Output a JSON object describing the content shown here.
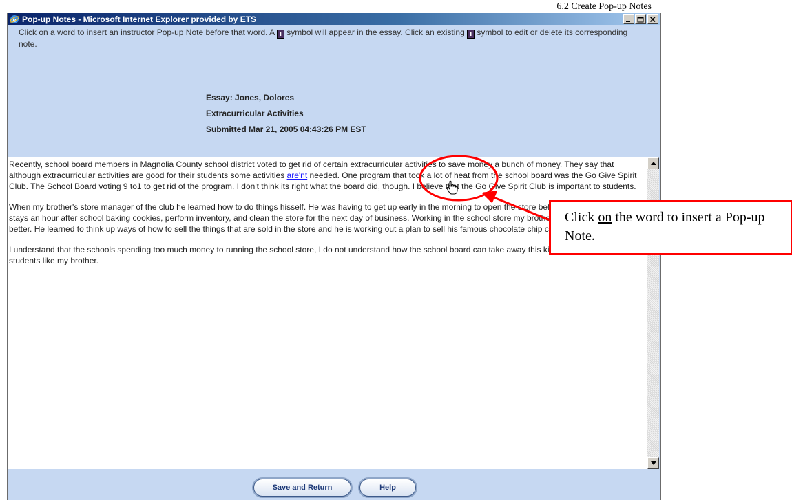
{
  "section_heading": "6.2 Create Pop-up Notes",
  "window": {
    "title": "Pop-up Notes - Microsoft Internet Explorer provided by ETS",
    "controls": [
      "minimize-icon",
      "maximize-icon",
      "close-icon"
    ]
  },
  "instructions": {
    "part1": "Click on a word to insert an instructor Pop-up Note before that word. A ",
    "symbol": "I",
    "part2": " symbol will appear in the essay. Click an existing ",
    "part3": " symbol to edit or delete its corresponding note."
  },
  "essay_header": {
    "essay": "Essay: Jones, Dolores",
    "title": "Extracurricular Activities",
    "submitted": "Submitted Mar 21, 2005 04:43:26 PM EST"
  },
  "essay": {
    "p1_before": "Recently, school board members in Magnolia County school district voted to get rid of certain extracurricular activities to save money a bunch of money. They say that although extracurricular activities are good for their students some activities ",
    "p1_link": "are'nt",
    "p1_after": " needed. One program that took a lot of heat from the school board was the Go Give Spirit Club. The School Board voting 9 to1 to get rid of the program. I don't think its right what the board did, though. I believe that the Go Give Spirit Club is important to students.",
    "p2": "When my brother's store manager of the club he learned how to do things hisself. He was having to get up early in the morning to open the store before school begun, and he stays an hour after school baking cookies, perform inventory, and clean the store for the next day of business. Working in the school store my brother learned how to think better. He learned to think up ways of how to sell the things that are sold in the store and he is working out a plan to sell his famous chocolate chip cookies.",
    "p3": "I understand that the schools spending too much money to running the school store, I do not understand how the school board can take away this kind of chance from other students like my brother."
  },
  "buttons": {
    "save": "Save and Return",
    "help": "Help"
  },
  "callout": {
    "before": "Click ",
    "underlined": "on",
    "after": " the word to insert a Pop-up Note."
  },
  "colors": {
    "window_bg": "#c6d8f2",
    "titlebar": "#0a246a",
    "annotation": "#ff0000",
    "link": "#1a1aff"
  }
}
